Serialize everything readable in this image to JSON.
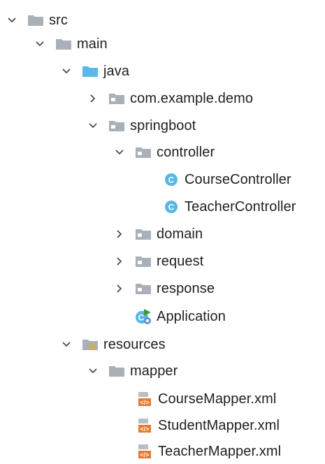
{
  "project_tree": {
    "nodes": [
      {
        "label": "src",
        "icon": "folder-icon",
        "expanded": true
      },
      {
        "label": "main",
        "icon": "folder-icon",
        "expanded": true
      },
      {
        "label": "java",
        "icon": "source-folder-icon",
        "expanded": true
      },
      {
        "label": "com.example.demo",
        "icon": "package-icon",
        "expanded": false
      },
      {
        "label": "springboot",
        "icon": "package-icon",
        "expanded": true
      },
      {
        "label": "controller",
        "icon": "package-icon",
        "expanded": true
      },
      {
        "label": "CourseController",
        "icon": "java-class-icon"
      },
      {
        "label": "TeacherController",
        "icon": "java-class-icon"
      },
      {
        "label": "domain",
        "icon": "package-icon",
        "expanded": false
      },
      {
        "label": "request",
        "icon": "package-icon",
        "expanded": false
      },
      {
        "label": "response",
        "icon": "package-icon",
        "expanded": false
      },
      {
        "label": "Application",
        "icon": "spring-boot-application-icon"
      },
      {
        "label": "resources",
        "icon": "resources-folder-icon",
        "expanded": true
      },
      {
        "label": "mapper",
        "icon": "folder-icon",
        "expanded": true
      },
      {
        "label": "CourseMapper.xml",
        "icon": "xml-file-icon"
      },
      {
        "label": "StudentMapper.xml",
        "icon": "xml-file-icon"
      },
      {
        "label": "TeacherMapper.xml",
        "icon": "xml-file-icon"
      }
    ]
  },
  "colors": {
    "folder": "#A9B0B8",
    "source_folder": "#5BB8E8",
    "resources_lines": "#E5A82E",
    "class_badge": "#57B7E6",
    "xml_tag": "#E67A2E",
    "text": "#1F1F1F",
    "chevron": "#4A4A4A"
  }
}
